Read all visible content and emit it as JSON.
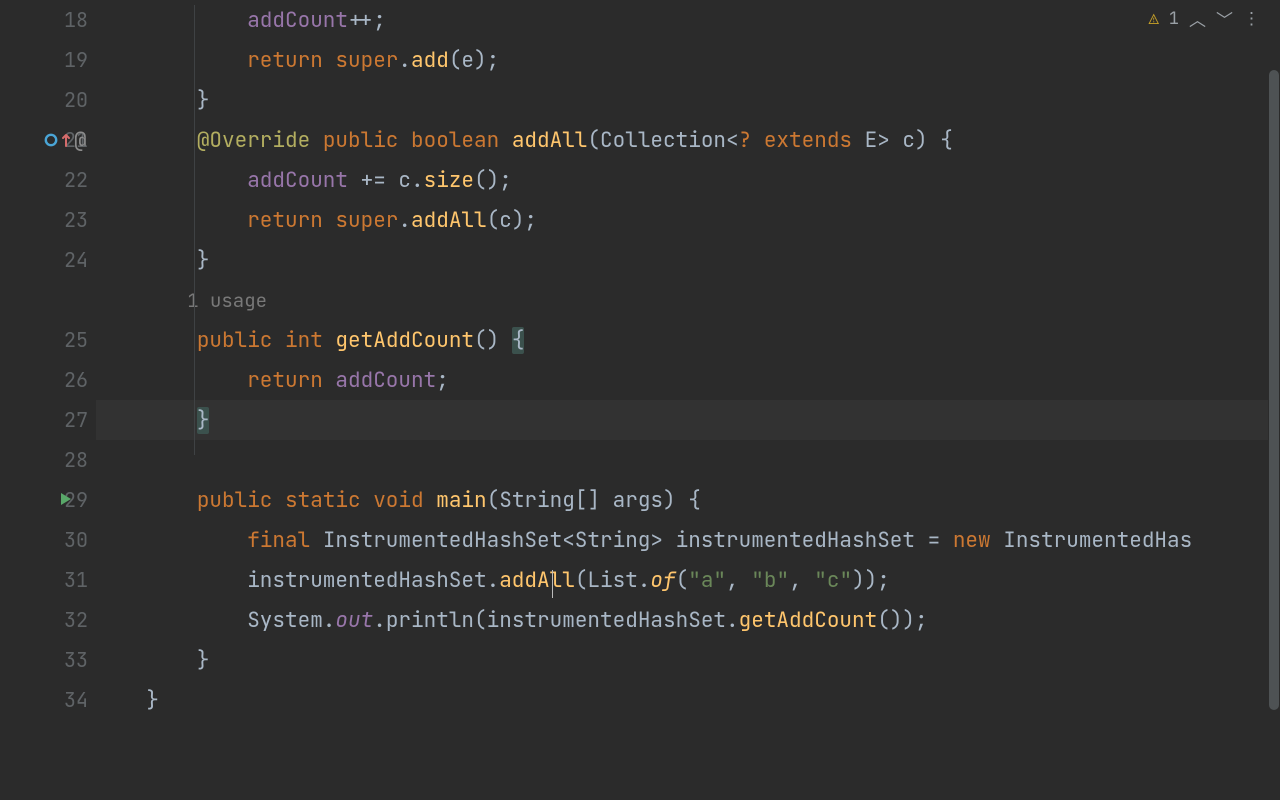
{
  "status": {
    "warning_count": "1"
  },
  "hints": {
    "usage_1": "1 usage"
  },
  "lines": [
    {
      "num": "18",
      "ind": "            ",
      "tokens": [
        [
          "fld",
          "addCount"
        ],
        [
          "punc",
          "++;"
        ]
      ]
    },
    {
      "num": "19",
      "ind": "            ",
      "tokens": [
        [
          "spr",
          "return super"
        ],
        [
          "punc",
          "."
        ],
        [
          "mtd",
          "add"
        ],
        [
          "punc",
          "(e);"
        ]
      ]
    },
    {
      "num": "20",
      "ind": "        ",
      "tokens": [
        [
          "punc",
          "}"
        ]
      ]
    },
    {
      "num": "21",
      "ind": "        ",
      "icon": "override",
      "tokens": [
        [
          "ann",
          "@Override "
        ],
        [
          "kw",
          "public boolean "
        ],
        [
          "mtd",
          "addAll"
        ],
        [
          "punc",
          "(Collection<"
        ],
        [
          "kw",
          "? extends "
        ],
        [
          "ov",
          "E"
        ],
        [
          "punc",
          "> c) {"
        ]
      ]
    },
    {
      "num": "22",
      "ind": "            ",
      "tokens": [
        [
          "fld",
          "addCount"
        ],
        [
          "punc",
          " += c."
        ],
        [
          "mtd",
          "size"
        ],
        [
          "punc",
          "();"
        ]
      ]
    },
    {
      "num": "23",
      "ind": "            ",
      "tokens": [
        [
          "spr",
          "return super"
        ],
        [
          "punc",
          "."
        ],
        [
          "mtd",
          "addAll"
        ],
        [
          "punc",
          "(c);"
        ]
      ]
    },
    {
      "num": "24",
      "ind": "        ",
      "tokens": [
        [
          "punc",
          "}"
        ]
      ]
    },
    {
      "hint": "usage_1",
      "ind": "        "
    },
    {
      "num": "25",
      "ind": "        ",
      "tokens": [
        [
          "kw",
          "public int "
        ],
        [
          "mtd",
          "getAddCount"
        ],
        [
          "punc",
          "() "
        ],
        [
          "brace",
          "{"
        ]
      ]
    },
    {
      "num": "26",
      "ind": "            ",
      "tokens": [
        [
          "spr",
          "return "
        ],
        [
          "fld",
          "addCount"
        ],
        [
          "punc",
          ";"
        ]
      ]
    },
    {
      "num": "27",
      "ind": "        ",
      "current": true,
      "tokens": [
        [
          "brace",
          "}"
        ]
      ]
    },
    {
      "num": "28",
      "ind": "",
      "tokens": []
    },
    {
      "num": "29",
      "ind": "        ",
      "icon": "run",
      "tokens": [
        [
          "kw",
          "public static void "
        ],
        [
          "mtd",
          "main"
        ],
        [
          "punc",
          "(String[] args) {"
        ]
      ]
    },
    {
      "num": "30",
      "ind": "            ",
      "tokens": [
        [
          "kw",
          "final "
        ],
        [
          "idn",
          "InstrumentedHashSet<String> instrumentedHashSet = "
        ],
        [
          "kw",
          "new "
        ],
        [
          "idn",
          "InstrumentedHas"
        ]
      ]
    },
    {
      "num": "31",
      "ind": "            ",
      "tokens": [
        [
          "idn",
          "instrumentedHashSet."
        ],
        [
          "mtd",
          "addAll"
        ],
        [
          "punc",
          "(List."
        ],
        [
          "mtdi",
          "of"
        ],
        [
          "punc",
          "("
        ],
        [
          "str",
          "\"a\""
        ],
        [
          "punc",
          ", "
        ],
        [
          "str",
          "\"b\""
        ],
        [
          "punc",
          ", "
        ],
        [
          "str",
          "\"c\""
        ],
        [
          "punc",
          "));"
        ]
      ]
    },
    {
      "num": "32",
      "ind": "            ",
      "tokens": [
        [
          "idn",
          "System."
        ],
        [
          "stat",
          "out"
        ],
        [
          "punc",
          ".println(instrumentedHashSet."
        ],
        [
          "mtd",
          "getAddCount"
        ],
        [
          "punc",
          "());"
        ]
      ]
    },
    {
      "num": "33",
      "ind": "        ",
      "tokens": [
        [
          "punc",
          "}"
        ]
      ]
    },
    {
      "num": "34",
      "ind": "    ",
      "tokens": [
        [
          "punc",
          "}"
        ]
      ]
    }
  ]
}
